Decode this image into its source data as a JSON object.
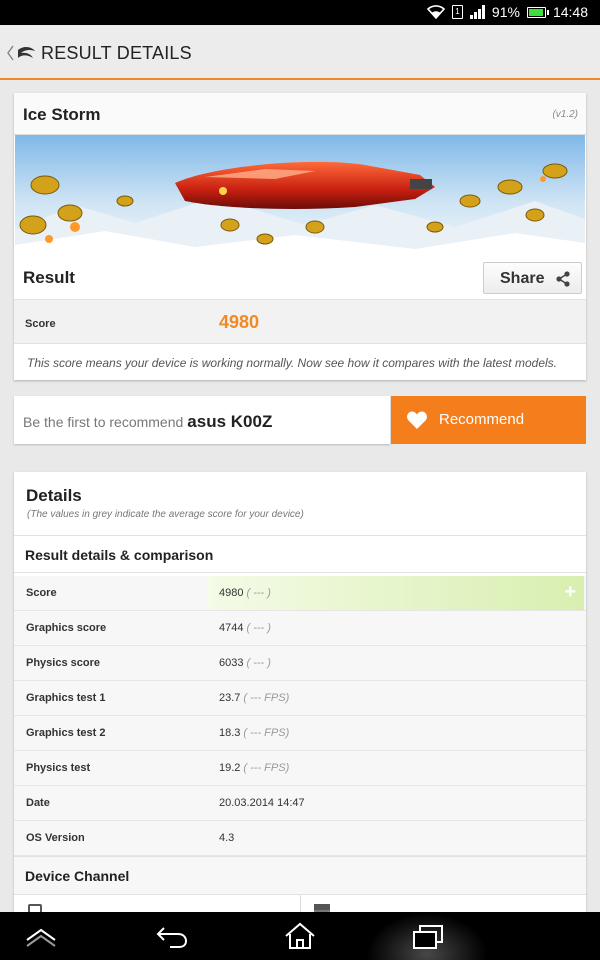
{
  "status_bar": {
    "battery": "91%",
    "time": "14:48",
    "sim_label": "1",
    "battery_level": 0.91,
    "icons": [
      "wifi-icon",
      "sim-icon",
      "signal-icon",
      "battery-icon"
    ]
  },
  "header": {
    "title": "RESULT DETAILS",
    "accent_color": "#f08a24"
  },
  "test": {
    "name": "Ice Storm",
    "version": "(v1.2)"
  },
  "result": {
    "label": "Result",
    "share_label": "Share",
    "score_label": "Score",
    "score_value": "4980",
    "note": "This score means your device is working normally. Now see how it compares with the latest models."
  },
  "recommend": {
    "prompt": "Be the first to recommend",
    "device": "asus K00Z",
    "button_label": "Recommend",
    "button_color": "#f47d1c"
  },
  "details": {
    "title": "Details",
    "subtitle": "(The values in grey indicate the average score for your device)",
    "section_title": "Result details & comparison",
    "rows": [
      {
        "label": "Score",
        "value": "4980",
        "avg": "( --- )"
      },
      {
        "label": "Graphics score",
        "value": "4744",
        "avg": "( --- )"
      },
      {
        "label": "Physics score",
        "value": "6033",
        "avg": "( --- )"
      },
      {
        "label": "Graphics test 1",
        "value": "23.7",
        "avg": "( --- FPS)"
      },
      {
        "label": "Graphics test 2",
        "value": "18.3",
        "avg": "( --- FPS)"
      },
      {
        "label": "Physics test",
        "value": "19.2",
        "avg": "( --- FPS)"
      },
      {
        "label": "Date",
        "value": "20.03.2014 14:47",
        "avg": ""
      },
      {
        "label": "OS Version",
        "value": "4.3",
        "avg": ""
      }
    ],
    "channel_title": "Device Channel"
  },
  "nav": {
    "icons": [
      "up-icon",
      "back-icon",
      "home-icon",
      "recent-apps-icon"
    ]
  }
}
